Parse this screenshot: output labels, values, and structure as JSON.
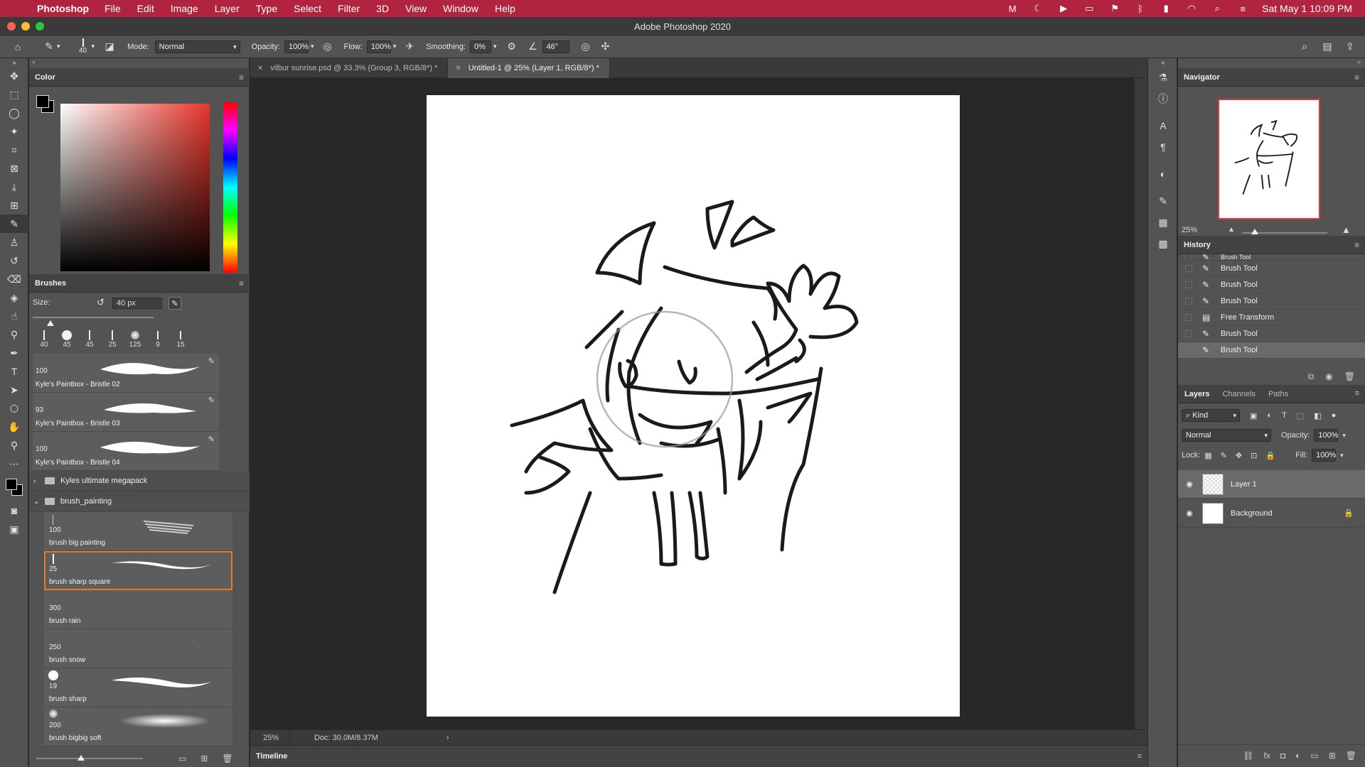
{
  "menubar": {
    "app_name": "Photoshop",
    "items": [
      "File",
      "Edit",
      "Image",
      "Layer",
      "Type",
      "Select",
      "Filter",
      "3D",
      "View",
      "Window",
      "Help"
    ],
    "clock": "Sat May 1  10:09 PM"
  },
  "window": {
    "title": "Adobe Photoshop 2020"
  },
  "options": {
    "brush_size": "40",
    "mode_label": "Mode:",
    "mode_value": "Normal",
    "opacity_label": "Opacity:",
    "opacity_value": "100%",
    "flow_label": "Flow:",
    "flow_value": "100%",
    "smoothing_label": "Smoothing:",
    "smoothing_value": "0%",
    "angle_value": "46°"
  },
  "color_panel": {
    "title": "Color",
    "foreground": "#000000",
    "background": "#000000"
  },
  "brushes_panel": {
    "title": "Brushes",
    "size_label": "Size:",
    "size_value": "40 px",
    "presets": [
      "40",
      "45",
      "45",
      "25",
      "125",
      "9",
      "15"
    ],
    "top_brushes": [
      {
        "size": "100",
        "name": "Kyle's Paintbox - Bristle 02"
      },
      {
        "size": "93",
        "name": "Kyle's Paintbox - Bristle 03"
      },
      {
        "size": "100",
        "name": "Kyle's Paintbox - Bristle 04"
      }
    ],
    "groups": [
      "Kyles ultimate megapack",
      "brush_painting"
    ],
    "sub_brushes": [
      {
        "size": "100",
        "name": "brush big painting"
      },
      {
        "size": "25",
        "name": "brush sharp square"
      },
      {
        "size": "300",
        "name": "brush rain"
      },
      {
        "size": "250",
        "name": "brush snow"
      },
      {
        "size": "19",
        "name": "brush sharp"
      },
      {
        "size": "200",
        "name": "brush bigbig soft"
      }
    ]
  },
  "tabs": [
    {
      "label": "vilbur sunrise.psd @ 33.3% (Group 3, RGB/8*) *"
    },
    {
      "label": "Untitled-1 @ 25% (Layer 1, RGB/8*) *"
    }
  ],
  "status": {
    "zoom": "25%",
    "doc": "Doc: 30.0M/8.37M"
  },
  "timeline": {
    "title": "Timeline"
  },
  "navigator": {
    "title": "Navigator",
    "zoom": "25%"
  },
  "history": {
    "title": "History",
    "items": [
      "Brush Tool",
      "Brush Tool",
      "Brush Tool",
      "Brush Tool",
      "Free Transform",
      "Brush Tool",
      "Brush Tool"
    ]
  },
  "layers": {
    "tabs": [
      "Layers",
      "Channels",
      "Paths"
    ],
    "kind_value": "Kind",
    "blend_value": "Normal",
    "opacity_label": "Opacity:",
    "opacity_value": "100%",
    "lock_label": "Lock:",
    "fill_label": "Fill:",
    "fill_value": "100%",
    "items": [
      {
        "name": "Layer 1"
      },
      {
        "name": "Background"
      }
    ]
  },
  "colors": {
    "menubar": "#b0243f",
    "selection_outline": "#e87a2c",
    "nav_frame": "#e03a3a"
  }
}
